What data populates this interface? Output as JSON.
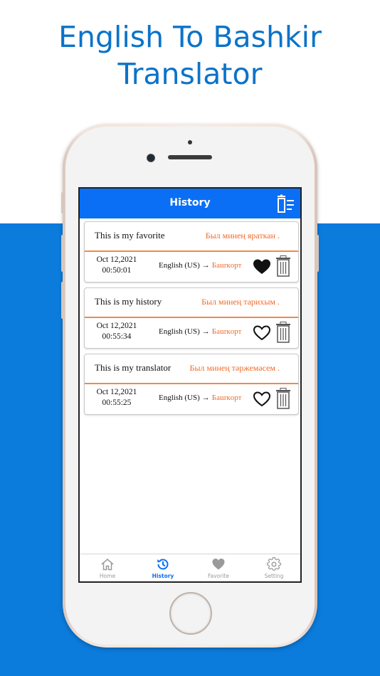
{
  "headline": {
    "line1": "English To Bashkir",
    "line2": "Translator"
  },
  "header": {
    "title": "History",
    "clear_icon": "clear-all-icon"
  },
  "history": [
    {
      "source": "This is my favorite",
      "translation": "Был минең яраткан .",
      "date": "Oct 12,2021",
      "time": "00:50:01",
      "from_lang": "English (US)",
      "arrow": "→",
      "to_lang": "Башҡорт",
      "favorite": true
    },
    {
      "source": "This is my history",
      "translation": "Был минең тарихым .",
      "date": "Oct 12,2021",
      "time": "00:55:34",
      "from_lang": "English (US)",
      "arrow": "→",
      "to_lang": "Башҡорт",
      "favorite": false
    },
    {
      "source": "This is my translator",
      "translation": "Был минең тәржемәсем .",
      "date": "Oct 12,2021",
      "time": "00:55:25",
      "from_lang": "English (US)",
      "arrow": "→",
      "to_lang": "Башҡорт",
      "favorite": false
    }
  ],
  "tabs": [
    {
      "label": "Home",
      "icon": "home-icon",
      "active": false
    },
    {
      "label": "History",
      "icon": "history-icon",
      "active": true
    },
    {
      "label": "Favorite",
      "icon": "heart-icon",
      "active": false
    },
    {
      "label": "Setting",
      "icon": "gear-icon",
      "active": false
    }
  ],
  "colors": {
    "brand_blue": "#0a6ff5",
    "background_blue": "#0b7bdc",
    "translation_orange": "#f06a2a",
    "headline_blue": "#0b73c9"
  }
}
